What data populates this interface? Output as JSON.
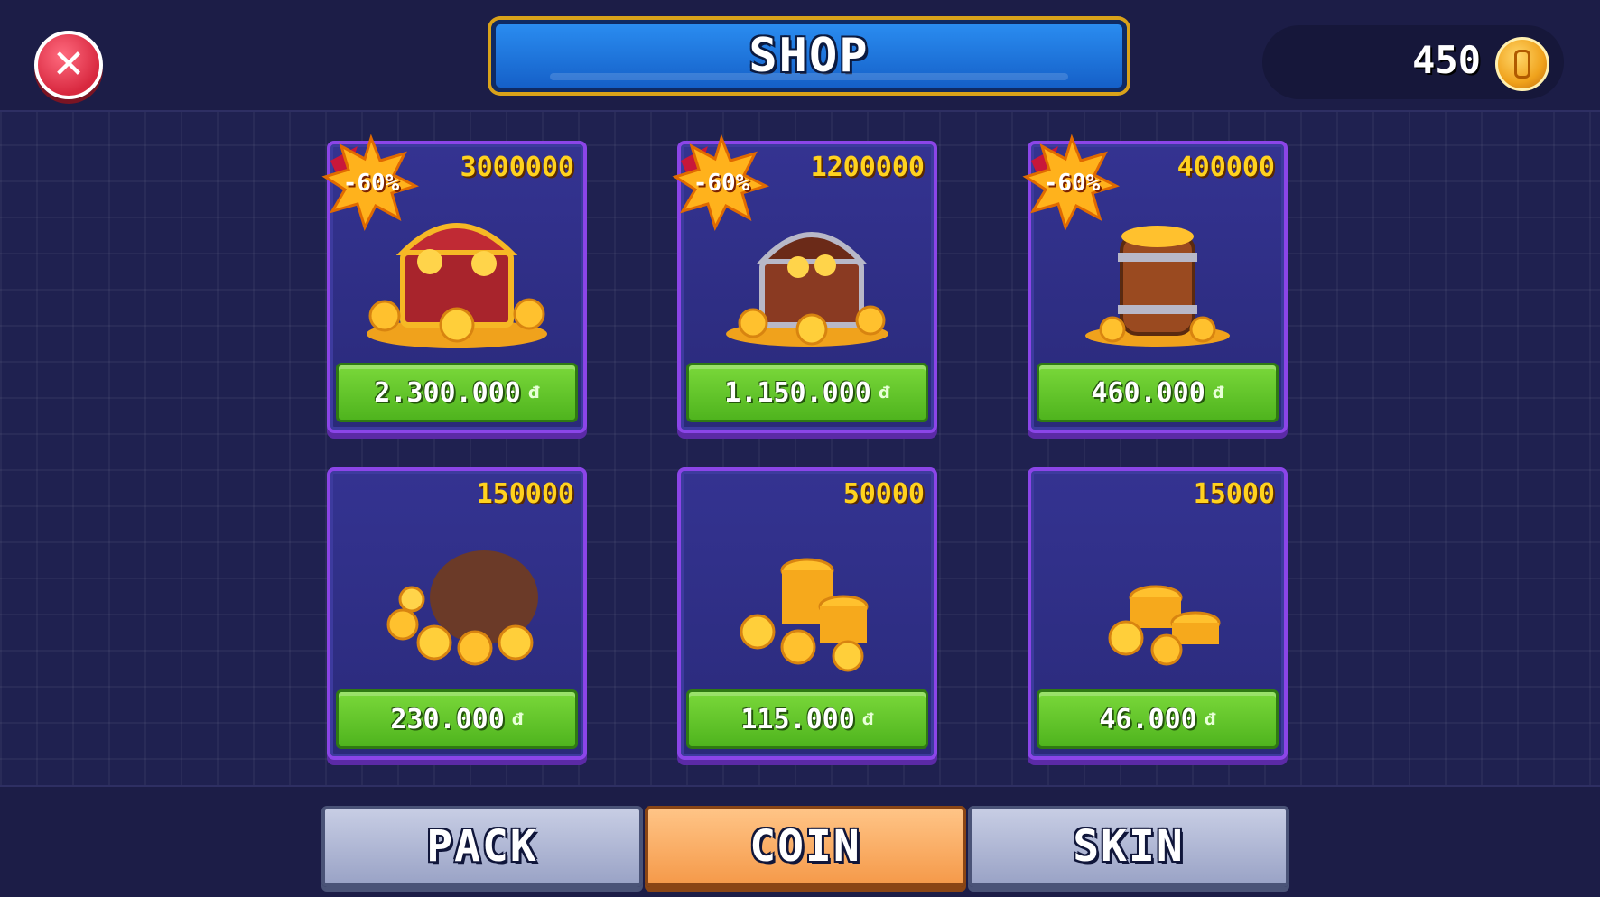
{
  "header": {
    "title": "SHOP",
    "currency_value": "450"
  },
  "items": [
    {
      "amount": "3000000",
      "price": "2.300.000",
      "currency_symbol": "đ",
      "badge": "-60%",
      "art": "treasure-chest-large"
    },
    {
      "amount": "1200000",
      "price": "1.150.000",
      "currency_symbol": "đ",
      "badge": "-60%",
      "art": "treasure-chest"
    },
    {
      "amount": "400000",
      "price": "460.000",
      "currency_symbol": "đ",
      "badge": "-60%",
      "art": "coin-barrel"
    },
    {
      "amount": "150000",
      "price": "230.000",
      "currency_symbol": "đ",
      "badge": "",
      "art": "coin-sack"
    },
    {
      "amount": "50000",
      "price": "115.000",
      "currency_symbol": "đ",
      "badge": "",
      "art": "coin-pile"
    },
    {
      "amount": "15000",
      "price": "46.000",
      "currency_symbol": "đ",
      "badge": "",
      "art": "coin-stack"
    }
  ],
  "tabs": [
    {
      "label": "PACK",
      "active": false
    },
    {
      "label": "COIN",
      "active": true
    },
    {
      "label": "SKIN",
      "active": false
    }
  ],
  "colors": {
    "background": "#1d1e4a",
    "card": "#2f2f86",
    "card_border": "#8b45e8",
    "price_button": "#5cc427",
    "amount_text": "#ffd21f",
    "active_tab": "#f7a958",
    "inactive_tab": "#b4bbd8",
    "close_button": "#e8394f"
  }
}
